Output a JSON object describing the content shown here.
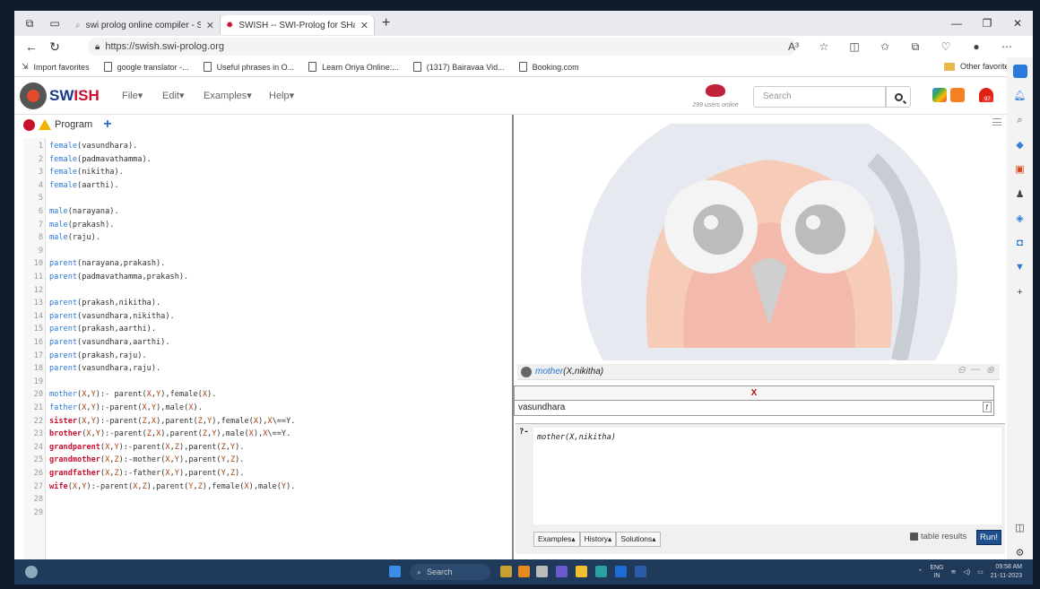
{
  "browser": {
    "tabs": [
      {
        "title": "swi prolog online compiler - Sear",
        "icon": "search-icon"
      },
      {
        "title": "SWISH -- SWI-Prolog for SHaring",
        "icon": "swish-icon"
      }
    ],
    "new_tab": "+",
    "url": "https://swish.swi-prolog.org",
    "read_aloud": "A³",
    "bookmarks": [
      "Import favorites",
      "google translator -...",
      "Useful phrases in O...",
      "Learn Oriya Online:...",
      "(1317) Bairavaa Vid...",
      "Booking.com"
    ],
    "other_favorites": "Other favorites"
  },
  "swish": {
    "brand_a": "SW",
    "brand_b": "ISH",
    "menu": [
      "File▾",
      "Edit▾",
      "Examples▾",
      "Help▾"
    ],
    "users_online": "299 users online",
    "search_placeholder": "Search",
    "notif_count": "97",
    "program_tab": "Program",
    "add_tab": "+"
  },
  "code_lines": [
    [
      [
        "p",
        "female"
      ],
      [
        "t",
        "(vasundhara)."
      ]
    ],
    [
      [
        "p",
        "female"
      ],
      [
        "t",
        "(padmavathamma)."
      ]
    ],
    [
      [
        "p",
        "female"
      ],
      [
        "t",
        "(nikitha)."
      ]
    ],
    [
      [
        "p",
        "female"
      ],
      [
        "t",
        "(aarthi)."
      ]
    ],
    [],
    [
      [
        "p",
        "male"
      ],
      [
        "t",
        "(narayana)."
      ]
    ],
    [
      [
        "p",
        "male"
      ],
      [
        "t",
        "(prakash)."
      ]
    ],
    [
      [
        "p",
        "male"
      ],
      [
        "t",
        "(raju)."
      ]
    ],
    [],
    [
      [
        "p",
        "parent"
      ],
      [
        "t",
        "(narayana,prakash)."
      ]
    ],
    [
      [
        "p",
        "parent"
      ],
      [
        "t",
        "(padmavathamma,prakash)."
      ]
    ],
    [],
    [
      [
        "p",
        "parent"
      ],
      [
        "t",
        "(prakash,nikitha)."
      ]
    ],
    [
      [
        "p",
        "parent"
      ],
      [
        "t",
        "(vasundhara,nikitha)."
      ]
    ],
    [
      [
        "p",
        "parent"
      ],
      [
        "t",
        "(prakash,aarthi)."
      ]
    ],
    [
      [
        "p",
        "parent"
      ],
      [
        "t",
        "(vasundhara,aarthi)."
      ]
    ],
    [
      [
        "p",
        "parent"
      ],
      [
        "t",
        "(prakash,raju)."
      ]
    ],
    [
      [
        "p",
        "parent"
      ],
      [
        "t",
        "(vasundhara,raju)."
      ]
    ],
    [],
    [
      [
        "p",
        "mother"
      ],
      [
        "t",
        "("
      ],
      [
        "v",
        "X"
      ],
      [
        "t",
        ","
      ],
      [
        "v",
        "Y"
      ],
      [
        "t",
        "):- parent("
      ],
      [
        "v",
        "X"
      ],
      [
        "t",
        ","
      ],
      [
        "v",
        "Y"
      ],
      [
        "t",
        "),female("
      ],
      [
        "v",
        "X"
      ],
      [
        "t",
        ")."
      ]
    ],
    [
      [
        "p",
        "father"
      ],
      [
        "t",
        "("
      ],
      [
        "v",
        "X"
      ],
      [
        "t",
        ","
      ],
      [
        "v",
        "Y"
      ],
      [
        "t",
        "):-parent("
      ],
      [
        "v",
        "X"
      ],
      [
        "t",
        ","
      ],
      [
        "v",
        "Y"
      ],
      [
        "t",
        "),male("
      ],
      [
        "v",
        "X"
      ],
      [
        "t",
        ")."
      ]
    ],
    [
      [
        "h",
        "sister"
      ],
      [
        "t",
        "("
      ],
      [
        "v",
        "X"
      ],
      [
        "t",
        ","
      ],
      [
        "v",
        "Y"
      ],
      [
        "t",
        "):-parent("
      ],
      [
        "v",
        "Z"
      ],
      [
        "t",
        ","
      ],
      [
        "v",
        "X"
      ],
      [
        "t",
        "),parent("
      ],
      [
        "v",
        "Z"
      ],
      [
        "t",
        ","
      ],
      [
        "v",
        "Y"
      ],
      [
        "t",
        "),female("
      ],
      [
        "v",
        "X"
      ],
      [
        "t",
        "),"
      ],
      [
        "v",
        "X"
      ],
      [
        "t",
        "\\==Y."
      ]
    ],
    [
      [
        "h",
        "brother"
      ],
      [
        "t",
        "("
      ],
      [
        "v",
        "X"
      ],
      [
        "t",
        ","
      ],
      [
        "v",
        "Y"
      ],
      [
        "t",
        "):-parent("
      ],
      [
        "v",
        "Z"
      ],
      [
        "t",
        ","
      ],
      [
        "v",
        "X"
      ],
      [
        "t",
        "),parent("
      ],
      [
        "v",
        "Z"
      ],
      [
        "t",
        ","
      ],
      [
        "v",
        "Y"
      ],
      [
        "t",
        "),male("
      ],
      [
        "v",
        "X"
      ],
      [
        "t",
        "),"
      ],
      [
        "v",
        "X"
      ],
      [
        "t",
        "\\==Y."
      ]
    ],
    [
      [
        "h",
        "grandparent"
      ],
      [
        "t",
        "("
      ],
      [
        "v",
        "X"
      ],
      [
        "t",
        ","
      ],
      [
        "v",
        "Y"
      ],
      [
        "t",
        "):-parent("
      ],
      [
        "v",
        "X"
      ],
      [
        "t",
        ","
      ],
      [
        "v",
        "Z"
      ],
      [
        "t",
        "),parent("
      ],
      [
        "v",
        "Z"
      ],
      [
        "t",
        ","
      ],
      [
        "v",
        "Y"
      ],
      [
        "t",
        ")."
      ]
    ],
    [
      [
        "h",
        "grandmother"
      ],
      [
        "t",
        "("
      ],
      [
        "v",
        "X"
      ],
      [
        "t",
        ","
      ],
      [
        "v",
        "Z"
      ],
      [
        "t",
        "):-mother("
      ],
      [
        "v",
        "X"
      ],
      [
        "t",
        ","
      ],
      [
        "v",
        "Y"
      ],
      [
        "t",
        "),parent("
      ],
      [
        "v",
        "Y"
      ],
      [
        "t",
        ","
      ],
      [
        "v",
        "Z"
      ],
      [
        "t",
        ")."
      ]
    ],
    [
      [
        "h",
        "grandfather"
      ],
      [
        "t",
        "("
      ],
      [
        "v",
        "X"
      ],
      [
        "t",
        ","
      ],
      [
        "v",
        "Z"
      ],
      [
        "t",
        "):-father("
      ],
      [
        "v",
        "X"
      ],
      [
        "t",
        ","
      ],
      [
        "v",
        "Y"
      ],
      [
        "t",
        "),parent("
      ],
      [
        "v",
        "Y"
      ],
      [
        "t",
        ","
      ],
      [
        "v",
        "Z"
      ],
      [
        "t",
        ")."
      ]
    ],
    [
      [
        "h",
        "wife"
      ],
      [
        "t",
        "("
      ],
      [
        "v",
        "X"
      ],
      [
        "t",
        ","
      ],
      [
        "v",
        "Y"
      ],
      [
        "t",
        "):-parent("
      ],
      [
        "v",
        "X"
      ],
      [
        "t",
        ","
      ],
      [
        "v",
        "Z"
      ],
      [
        "t",
        "),parent("
      ],
      [
        "v",
        "Y"
      ],
      [
        "t",
        ","
      ],
      [
        "v",
        "Z"
      ],
      [
        "t",
        "),female("
      ],
      [
        "v",
        "X"
      ],
      [
        "t",
        "),male("
      ],
      [
        "v",
        "Y"
      ],
      [
        "t",
        ")."
      ]
    ],
    [],
    []
  ],
  "query": {
    "title_pred": "mother",
    "title_args": "(X,nikitha)",
    "column": "X",
    "result": "vasundhara",
    "prompt": "?-",
    "input": "mother(X,nikitha)",
    "buttons": [
      "Examples▴",
      "History▴",
      "Solutions▴"
    ],
    "table_results": "table results",
    "run": "Run!"
  },
  "taskbar": {
    "search": "Search",
    "lang": "ENG",
    "region": "IN",
    "time": "09:58 AM",
    "date": "21-11-2023"
  }
}
